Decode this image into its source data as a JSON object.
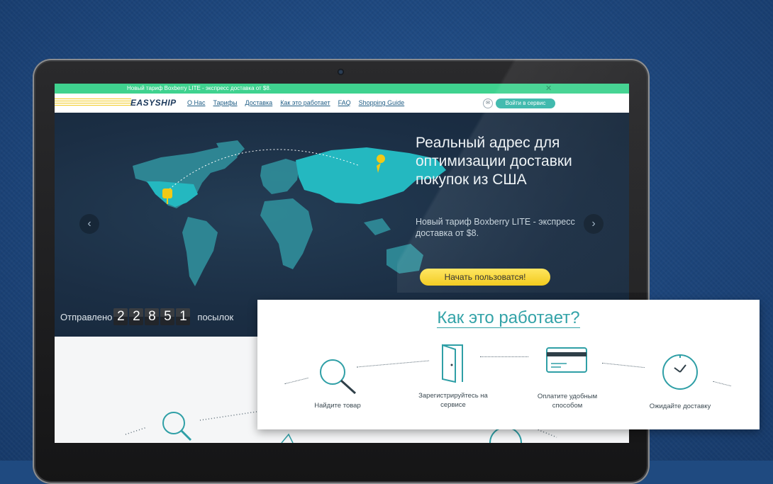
{
  "promo_bar": {
    "text": "Новый тариф Boxberry LITE - экспресс доставка от $8.",
    "close": "✕"
  },
  "nav": {
    "logo": "EASYSHIP",
    "links": [
      "О Нас",
      "Тарифы",
      "Доставка",
      "Как это работает",
      "FAQ",
      "Shopping Guide"
    ],
    "mail_icon": "✉",
    "login_label": "Войти в сервис"
  },
  "hero": {
    "headline": "Реальный адрес для оптимизации доставки покупок из США",
    "subtext": "Новый тариф Boxberry LITE - экспресс доставка от $8.",
    "cta_label": "Начать пользоватся!",
    "prev_arrow": "‹",
    "next_arrow": "›"
  },
  "counter": {
    "before": "Отправлено",
    "digits": [
      "2",
      "2",
      "8",
      "5",
      "1"
    ],
    "after": "посылок"
  },
  "how_it_works": {
    "title": "Как это работает?",
    "steps": [
      {
        "label": "Найдите товар",
        "icon": "search-icon"
      },
      {
        "label": "Зарегистрируйтесь на сервисе",
        "icon": "door-icon"
      },
      {
        "label": "Оплатите удобным способом",
        "icon": "credit-card-icon"
      },
      {
        "label": "Ожидайте доставку",
        "icon": "clock-icon"
      }
    ]
  },
  "colors": {
    "accent": "#33a3a8",
    "promo": "#3fd28f",
    "cta": "#f2c916",
    "page_bg": "#1f4a80"
  }
}
